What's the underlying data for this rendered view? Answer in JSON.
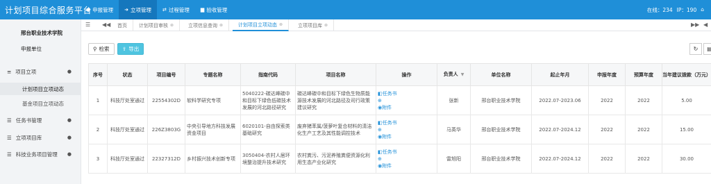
{
  "app": {
    "title": "计划项目综合服务平台",
    "online_label": "在线：234",
    "ip_label": "IP：190"
  },
  "nav": [
    {
      "label": "申报管理",
      "icon": "●"
    },
    {
      "label": "立项管理",
      "icon": "➜"
    },
    {
      "label": "过程管理",
      "icon": "⇄"
    },
    {
      "label": "验收管理",
      "icon": "▆"
    }
  ],
  "sidebar": {
    "org": "邢台职业技术学院",
    "org_role": "申报单位",
    "menu": [
      {
        "label": "项目立项",
        "icon": "≡",
        "caret": "●"
      },
      {
        "label": "任务书管理",
        "icon": "☰",
        "caret": "●"
      },
      {
        "label": "立项项目库",
        "icon": "☰",
        "caret": "●"
      },
      {
        "label": "科技业务项目管理",
        "icon": "☰",
        "caret": "●"
      }
    ],
    "submenu": [
      "计划项目立项动态",
      "基金项目立项动态"
    ]
  },
  "tabs": [
    "首页",
    "计划项目审核",
    "立项信息查询",
    "计划项目立项动态",
    "立项项目库"
  ],
  "toolbar": {
    "search": "检索",
    "export": "导出"
  },
  "table": {
    "headers": [
      "序号",
      "状态",
      "项目编号",
      "专题名称",
      "指南代码",
      "项目名称",
      "操作",
      "负责人",
      "单位名称",
      "起止年月",
      "申报年度",
      "预算年度",
      "当年建议拨款（万元）"
    ],
    "op_links": {
      "task": "任务书",
      "attach": "附件"
    },
    "rows": [
      {
        "no": "1",
        "status": "科技厅处室通过",
        "code": "22554302D",
        "topic": "软科学研究专项",
        "guide": "5040222-碳达峰碳中和目标下绿色低碳技术发展的河北路径研究",
        "name": "碳达峰碳中和目标下绿色生物质能源技术发展的河北路径及司行政策建议研究",
        "owner": "张新",
        "unit": "邢台职业技术学院",
        "period": "2022.07-2023.06",
        "year": "2022",
        "budget_year": "2022",
        "amount": "5.00"
      },
      {
        "no": "2",
        "status": "科技厅处室通过",
        "code": "226Z3803G",
        "topic": "中央引导地方科技发展资金项目",
        "guide": "6020101-自由探索类基础研究",
        "name": "废弃猪苯属/菠萝叶复合材料的清洁化生产工艺及其性能调控技术",
        "owner": "马英华",
        "unit": "邢台职业技术学院",
        "period": "2022.07-2024.12",
        "year": "2022",
        "budget_year": "2022",
        "amount": "15.00"
      },
      {
        "no": "3",
        "status": "科技厅处室通过",
        "code": "22327312D",
        "topic": "乡村振兴技术创新专项",
        "guide": "3050404-农村人居环境整治提升技术研究",
        "name": "农村粪污、污泥养殖粪便资源化利用生态产业化研究",
        "owner": "雷旭阳",
        "unit": "邢台职业技术学院",
        "period": "2022.07-2024.12",
        "year": "2022",
        "budget_year": "2022",
        "amount": "30.00"
      }
    ]
  }
}
